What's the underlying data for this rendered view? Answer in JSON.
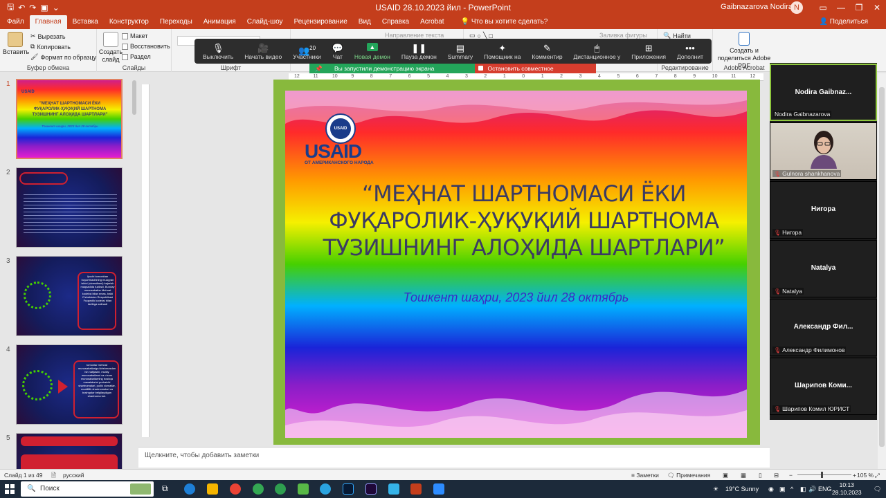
{
  "window": {
    "title": "USAID 28.10.2023 йил  -  PowerPoint",
    "user": "Gaibnazarova Nodira",
    "user_initial": "N",
    "qat_icons": [
      "save-icon",
      "undo-icon",
      "redo-icon",
      "start-slideshow-icon",
      "customize-icon"
    ]
  },
  "ribbon": {
    "tabs": [
      "Файл",
      "Главная",
      "Вставка",
      "Конструктор",
      "Переходы",
      "Анимация",
      "Слайд-шоу",
      "Рецензирование",
      "Вид",
      "Справка",
      "Acrobat"
    ],
    "active_tab": "Главная",
    "tell_me": "Что вы хотите сделать?",
    "share": "Поделиться",
    "clipboard": {
      "paste": "Вставить",
      "cut": "Вырезать",
      "copy": "Копировать",
      "format_painter": "Формат по образцу",
      "label": "Буфер обмена"
    },
    "slides": {
      "new_slide": "Создать слайд",
      "layout": "Макет",
      "reset": "Восстановить",
      "section": "Раздел",
      "label": "Слайды"
    },
    "font_label": "Шрифт",
    "paragraph_hint": "Направление текста",
    "shape_fill": "Заливка фигуры",
    "find": "Найти",
    "editing_label": "Редактирование",
    "acrobat": {
      "create": "Создать и поделиться Adobe PDF",
      "label": "Adobe Acrobat"
    }
  },
  "zoom_toolbar": {
    "buttons": [
      {
        "label": "Выключить",
        "icon": "microphone-icon"
      },
      {
        "label": "Начать видео",
        "icon": "video-off-icon"
      },
      {
        "label": "Участники",
        "icon": "participants-icon",
        "count": "20"
      },
      {
        "label": "Чат",
        "icon": "chat-icon"
      },
      {
        "label": "Новая демон",
        "icon": "share-screen-icon"
      },
      {
        "label": "Пауза демон",
        "icon": "pause-icon"
      },
      {
        "label": "Summary",
        "icon": "summary-icon"
      },
      {
        "label": "Помощник на",
        "icon": "ai-companion-icon"
      },
      {
        "label": "Комментир",
        "icon": "annotate-icon"
      },
      {
        "label": "Дистанционное у",
        "icon": "remote-control-icon"
      },
      {
        "label": "Приложения",
        "icon": "apps-icon"
      },
      {
        "label": "Дополнит",
        "icon": "more-icon"
      }
    ],
    "sharing_banner": "Вы запустили демонстрацию экрана",
    "stop_sharing": "Остановить совместное использование"
  },
  "thumbnails": [
    {
      "num": "1",
      "title_lines": [
        "\"МЕҲНАТ ШАРТНОМАСИ ЁКИ",
        "ФУҚАРОЛИК-ҲУҚУҚИЙ ШАРТНОМА",
        "ТУЗИШНИНГ АЛОҲИДА ШАРТЛАРИ\""
      ],
      "sub": "Тошкент шаҳри, 2023 йил 28 октябрь"
    },
    {
      "num": "2"
    },
    {
      "num": "3",
      "body": "Ijrochi tomonidan buyurtmachining muayyan ishini (xizmatlarni) bajarish maqsadida tuziladi. Bunday munosabatlar Mehnat kodeksi bilan emas, balki O'zbekiston Respublikasi Fuqarolik kodeksi bilan tartibga solinadi"
    },
    {
      "num": "4",
      "body": "tomonlar mehnat munosabatlariga kirishmasdan ish natijasini, mulkiy munosabatlarni va o'zaro munosabatlarning boshqa masalalarini pudratchi shartnomalari, pullik xizmatlar, mualliflik shartnomalari va boshqalar belgilaydigan shartnoma turi."
    },
    {
      "num": "5"
    }
  ],
  "slide": {
    "logo_text": "USAID",
    "logo_sub": "ОТ АМЕРИКАНСКОГО НАРОДА",
    "title_lines": [
      "“МЕҲНАТ ШАРТНОМАСИ ЁКИ",
      "ФУҚАРОЛИК-ҲУҚУҚИЙ ШАРТНОМА",
      "ТУЗИШНИНГ АЛОҲИДА ШАРТЛАРИ”"
    ],
    "subtitle": "Тошкент шаҳри, 2023 йил 28 октябрь",
    "background_colors": [
      "#d0208a",
      "#ff2a2a",
      "#ff9b00",
      "#f5f000",
      "#46d000",
      "#00b0ff",
      "#1a24d8",
      "#8a1ec8",
      "#e41ed0"
    ]
  },
  "notes_placeholder": "Щелкните, чтобы добавить заметки",
  "participants": [
    {
      "tile_name": "Nodira  Gaibnaz...",
      "label": "Nodira Gaibnazarova",
      "video": false,
      "muted": false,
      "active": true
    },
    {
      "tile_name": "",
      "label": "Gulnora  shankhanova",
      "video": true,
      "muted": true,
      "active": false
    },
    {
      "tile_name": "Нигора",
      "label": "Нигора",
      "video": false,
      "muted": true,
      "active": false
    },
    {
      "tile_name": "Natalya",
      "label": "Natalya",
      "video": false,
      "muted": true,
      "active": false
    },
    {
      "tile_name": "Александр  Фил...",
      "label": "Александр Филимонов",
      "video": false,
      "muted": true,
      "active": false
    },
    {
      "tile_name": "Шарипов  Коми...",
      "label": "Шарипов Комил ЮРИСТ",
      "video": false,
      "muted": true,
      "active": false
    }
  ],
  "status": {
    "slide_of": "Слайд 1 из 49",
    "language": "русский",
    "notes": "Заметки",
    "comments": "Примечания",
    "zoom": "105 %"
  },
  "taskbar": {
    "search": "Поиск",
    "weather": "19°C  Sunny",
    "lang": "ENG",
    "time": "10:13",
    "date": "28.10.2023"
  },
  "ruler_ticks": [
    "12",
    "11",
    "10",
    "9",
    "8",
    "7",
    "6",
    "5",
    "4",
    "3",
    "2",
    "1",
    "0",
    "1",
    "2",
    "3",
    "4",
    "5",
    "6",
    "7",
    "8",
    "9",
    "10",
    "11",
    "12"
  ],
  "accent": "#c43e1c"
}
